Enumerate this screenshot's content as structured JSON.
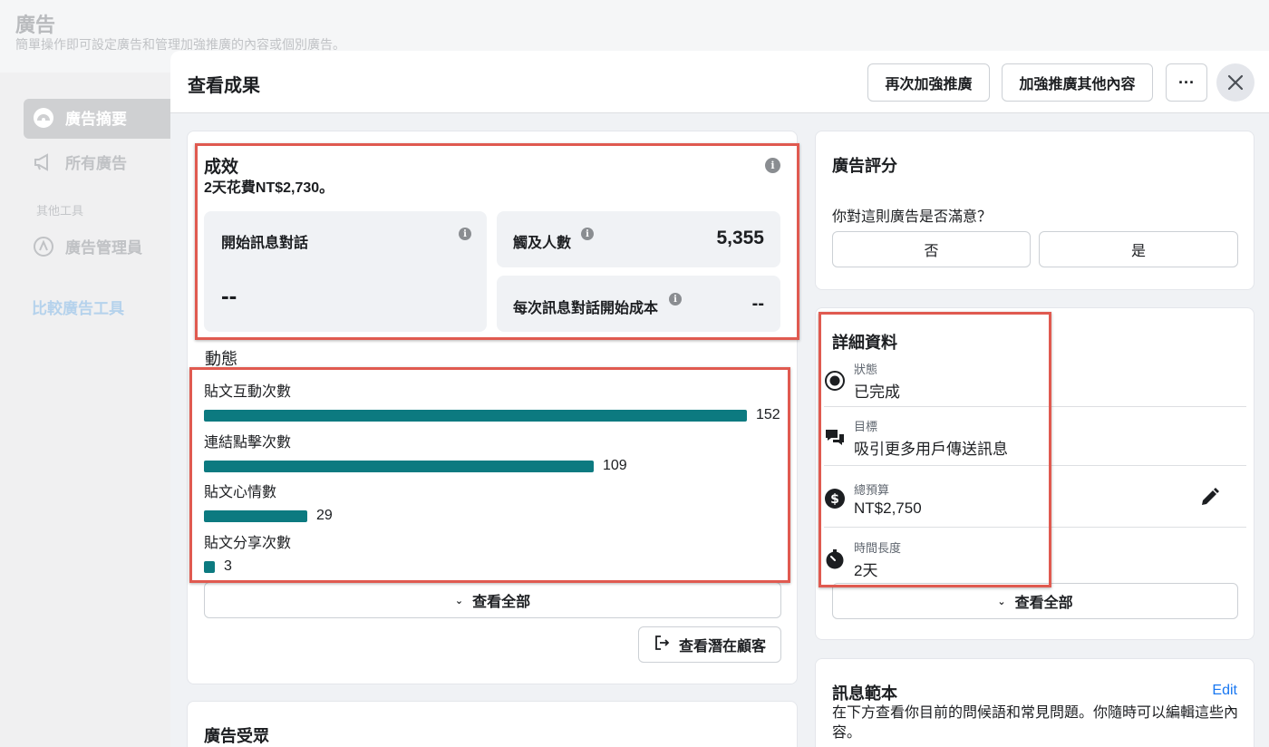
{
  "background": {
    "title": "廣告",
    "subtitle": "簡單操作即可設定廣告和管理加強推廣的內容或個別廣告。",
    "nav": [
      {
        "label": "廣告摘要",
        "icon": "dashboard-icon",
        "active": true
      },
      {
        "label": "所有廣告",
        "icon": "megaphone-icon",
        "active": false
      }
    ],
    "tools_label": "其他工具",
    "tools": [
      {
        "label": "廣告管理員",
        "icon": "ads-manager-icon"
      }
    ],
    "compare_link": "比較廣告工具"
  },
  "modal": {
    "title": "查看成果",
    "buttons": {
      "boost_again": "再次加強推廣",
      "boost_other": "加強推廣其他內容",
      "more": "···"
    }
  },
  "performance": {
    "title": "成效",
    "spend_summary": "2天花費NT$2,730。",
    "messaging": {
      "label": "開始訊息對話",
      "value": "--"
    },
    "reach": {
      "label": "觸及人數",
      "value": "5,355"
    },
    "cost_per_msg": {
      "label": "每次訊息對話開始成本",
      "value": "--"
    }
  },
  "activity": {
    "title": "動態",
    "max_value": 152,
    "items": [
      {
        "label": "貼文互動次數",
        "value": 152
      },
      {
        "label": "連結點擊次數",
        "value": 109
      },
      {
        "label": "貼文心情數",
        "value": 29
      },
      {
        "label": "貼文分享次數",
        "value": 3
      }
    ],
    "view_all": "查看全部",
    "view_leads": "查看潛在顧客"
  },
  "audience": {
    "title": "廣告受眾"
  },
  "rating": {
    "title": "廣告評分",
    "question": "你對這則廣告是否滿意？",
    "no": "否",
    "yes": "是"
  },
  "details": {
    "title": "詳細資料",
    "rows": [
      {
        "label": "狀態",
        "value": "已完成",
        "icon": "status-radio-icon"
      },
      {
        "label": "目標",
        "value": "吸引更多用戶傳送訊息",
        "icon": "chat-bubbles-icon"
      },
      {
        "label": "總預算",
        "value": "NT$2,750",
        "icon": "dollar-icon"
      },
      {
        "label": "時間長度",
        "value": "2天",
        "icon": "stopwatch-icon"
      }
    ],
    "view_all": "查看全部"
  },
  "message_template": {
    "title": "訊息範本",
    "edit": "Edit",
    "description": "在下方查看你目前的問候語和常見問題。你隨時可以編輯這些內容。"
  },
  "colors": {
    "bar": "#0c7a80",
    "highlight": "#e05a50",
    "link": "#1877f2"
  }
}
